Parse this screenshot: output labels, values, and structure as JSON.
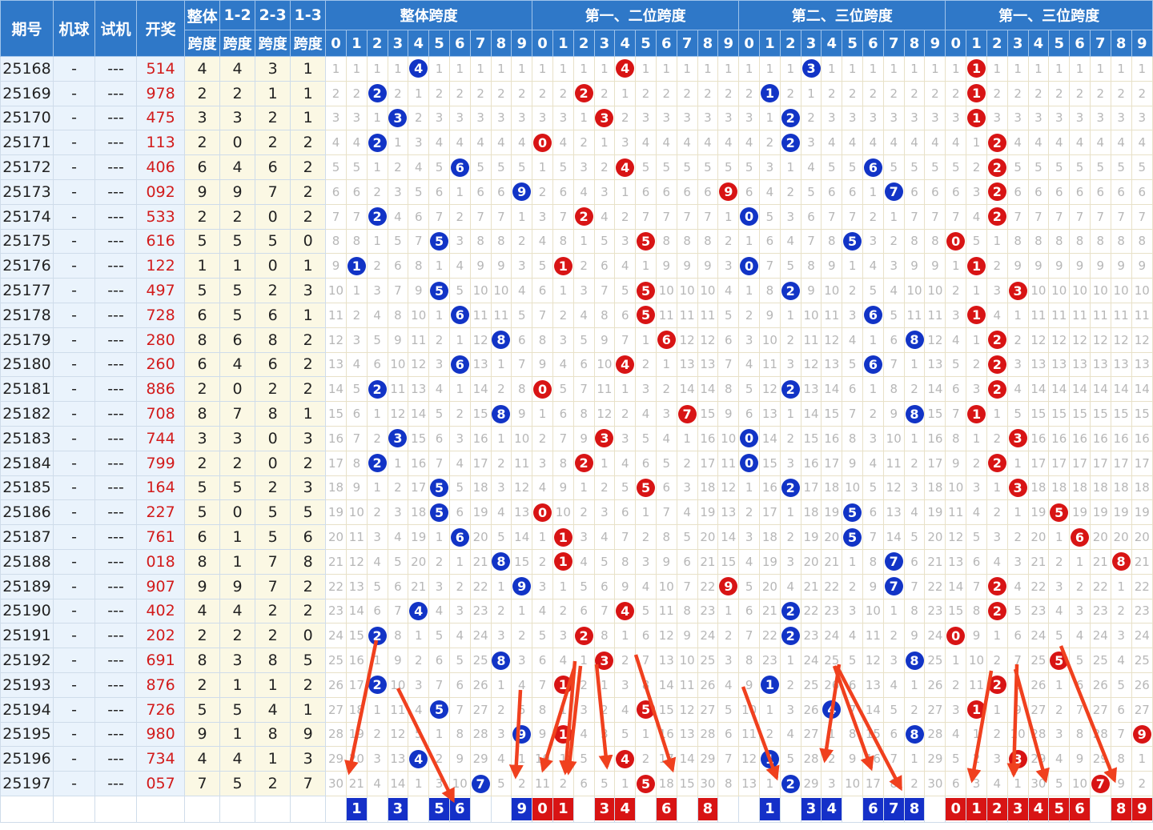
{
  "header": {
    "issue": "期号",
    "machine": "机球",
    "trial": "试机",
    "draw": "开奖",
    "span_all_top": "整体",
    "span_all_bottom": "跨度",
    "span12_top": "1-2",
    "span12_bottom": "跨度",
    "span23_top": "2-3",
    "span23_bottom": "跨度",
    "span13_top": "1-3",
    "span13_bottom": "跨度"
  },
  "sections": [
    {
      "title": "整体跨度",
      "ball_color": "blue"
    },
    {
      "title": "第一、二位跨度",
      "ball_color": "red"
    },
    {
      "title": "第二、三位跨度",
      "ball_color": "blue"
    },
    {
      "title": "第一、三位跨度",
      "ball_color": "red"
    }
  ],
  "digits": [
    "0",
    "1",
    "2",
    "3",
    "4",
    "5",
    "6",
    "7",
    "8",
    "9"
  ],
  "placeholders": {
    "machine": "-",
    "trial": "---"
  },
  "colors": {
    "header_bg": "#2f78c8",
    "blue_ball": "#1234c6",
    "red_ball": "#d81414",
    "arrow": "#f0401e"
  },
  "chart_data": {
    "type": "table",
    "columns": [
      "期号",
      "开奖",
      "整体跨度",
      "1-2跨度",
      "2-3跨度",
      "1-3跨度"
    ],
    "rows": [
      {
        "issue": "25168",
        "draw": "514",
        "spans": [
          4,
          4,
          3,
          1
        ]
      },
      {
        "issue": "25169",
        "draw": "978",
        "spans": [
          2,
          2,
          1,
          1
        ]
      },
      {
        "issue": "25170",
        "draw": "475",
        "spans": [
          3,
          3,
          2,
          1
        ]
      },
      {
        "issue": "25171",
        "draw": "113",
        "spans": [
          2,
          0,
          2,
          2
        ]
      },
      {
        "issue": "25172",
        "draw": "406",
        "spans": [
          6,
          4,
          6,
          2
        ]
      },
      {
        "issue": "25173",
        "draw": "092",
        "spans": [
          9,
          9,
          7,
          2
        ]
      },
      {
        "issue": "25174",
        "draw": "533",
        "spans": [
          2,
          2,
          0,
          2
        ]
      },
      {
        "issue": "25175",
        "draw": "616",
        "spans": [
          5,
          5,
          5,
          0
        ]
      },
      {
        "issue": "25176",
        "draw": "122",
        "spans": [
          1,
          1,
          0,
          1
        ]
      },
      {
        "issue": "25177",
        "draw": "497",
        "spans": [
          5,
          5,
          2,
          3
        ]
      },
      {
        "issue": "25178",
        "draw": "728",
        "spans": [
          6,
          5,
          6,
          1
        ]
      },
      {
        "issue": "25179",
        "draw": "280",
        "spans": [
          8,
          6,
          8,
          2
        ]
      },
      {
        "issue": "25180",
        "draw": "260",
        "spans": [
          6,
          4,
          6,
          2
        ]
      },
      {
        "issue": "25181",
        "draw": "886",
        "spans": [
          2,
          0,
          2,
          2
        ]
      },
      {
        "issue": "25182",
        "draw": "708",
        "spans": [
          8,
          7,
          8,
          1
        ]
      },
      {
        "issue": "25183",
        "draw": "744",
        "spans": [
          3,
          3,
          0,
          3
        ]
      },
      {
        "issue": "25184",
        "draw": "799",
        "spans": [
          2,
          2,
          0,
          2
        ]
      },
      {
        "issue": "25185",
        "draw": "164",
        "spans": [
          5,
          5,
          2,
          3
        ]
      },
      {
        "issue": "25186",
        "draw": "227",
        "spans": [
          5,
          0,
          5,
          5
        ]
      },
      {
        "issue": "25187",
        "draw": "761",
        "spans": [
          6,
          1,
          5,
          6
        ]
      },
      {
        "issue": "25188",
        "draw": "018",
        "spans": [
          8,
          1,
          7,
          8
        ]
      },
      {
        "issue": "25189",
        "draw": "907",
        "spans": [
          9,
          9,
          7,
          2
        ]
      },
      {
        "issue": "25190",
        "draw": "402",
        "spans": [
          4,
          4,
          2,
          2
        ]
      },
      {
        "issue": "25191",
        "draw": "202",
        "spans": [
          2,
          2,
          2,
          0
        ]
      },
      {
        "issue": "25192",
        "draw": "691",
        "spans": [
          8,
          3,
          8,
          5
        ]
      },
      {
        "issue": "25193",
        "draw": "876",
        "spans": [
          2,
          1,
          1,
          2
        ]
      },
      {
        "issue": "25194",
        "draw": "726",
        "spans": [
          5,
          5,
          4,
          1
        ]
      },
      {
        "issue": "25195",
        "draw": "980",
        "spans": [
          9,
          1,
          8,
          9
        ]
      },
      {
        "issue": "25196",
        "draw": "734",
        "spans": [
          4,
          4,
          1,
          3
        ]
      },
      {
        "issue": "25197",
        "draw": "057",
        "spans": [
          7,
          5,
          2,
          7
        ]
      }
    ],
    "predictions": [
      [
        "1",
        "3",
        "5",
        "6",
        "9"
      ],
      [
        "0",
        "1",
        "3",
        "4",
        "6",
        "8"
      ],
      [
        "1",
        "3",
        "4",
        "6",
        "7",
        "8"
      ],
      [
        "0",
        "1",
        "2",
        "3",
        "4",
        "5",
        "6",
        "8",
        "9"
      ]
    ]
  }
}
